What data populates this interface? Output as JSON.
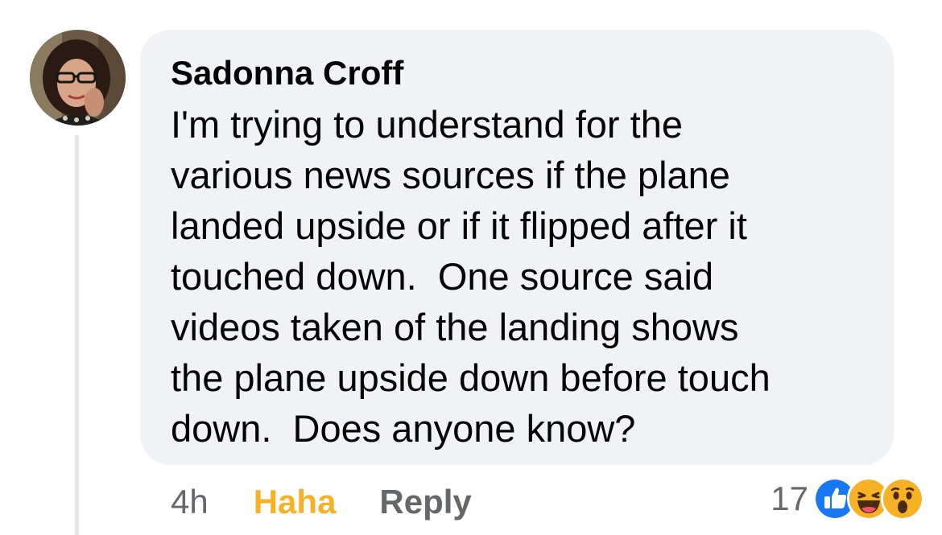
{
  "comment": {
    "author": "Sadonna Croff",
    "text": "I'm trying to understand for the\nvarious news sources if the plane\nlanded upside or if it flipped after it\ntouched down.  One source said\nvideos taken of the landing shows\nthe plane upside down before touch\ndown.  Does anyone know?",
    "timestamp": "4h",
    "reaction_button_label": "Haha",
    "reply_label": "Reply",
    "reaction_count": "17",
    "reaction_types": [
      "like-icon",
      "haha-icon",
      "wow-icon"
    ]
  },
  "colors": {
    "bubble_bg": "#f0f2f5",
    "text": "#050505",
    "secondary_text": "#65676b",
    "haha_yellow": "#f7b125",
    "like_blue": "#1877f2",
    "thread_line": "#e4e6eb"
  }
}
